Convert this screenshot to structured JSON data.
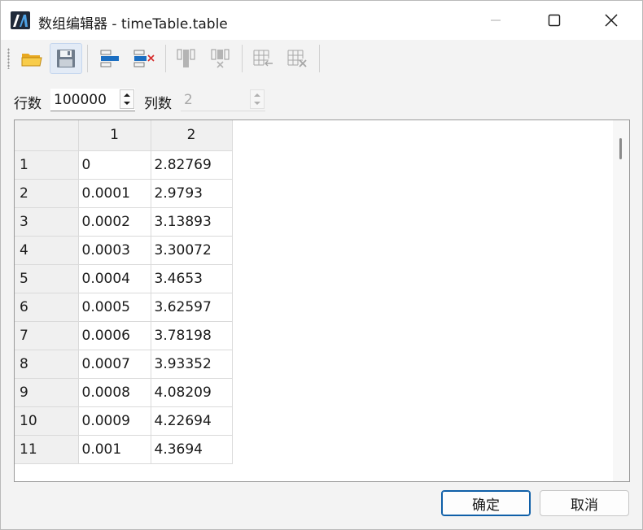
{
  "window": {
    "title": "数组编辑器 - timeTable.table"
  },
  "toolbar": {
    "buttons": [
      {
        "name": "open-folder",
        "icon": "folder-icon"
      },
      {
        "name": "save",
        "icon": "floppy-save-icon"
      },
      {
        "name": "insert-row",
        "icon": "insert-row-icon"
      },
      {
        "name": "delete-row",
        "icon": "delete-row-icon"
      },
      {
        "name": "insert-column",
        "icon": "insert-column-icon"
      },
      {
        "name": "delete-column",
        "icon": "delete-column-icon"
      },
      {
        "name": "insert-cells",
        "icon": "grid-insert-icon"
      },
      {
        "name": "delete-cells",
        "icon": "grid-delete-icon"
      }
    ]
  },
  "dims": {
    "rows_label": "行数",
    "rows_value": "100000",
    "cols_label": "列数",
    "cols_value": "2"
  },
  "table": {
    "columns": [
      "1",
      "2"
    ],
    "rows": [
      {
        "index": "1",
        "c1": "0",
        "c2": "2.82769"
      },
      {
        "index": "2",
        "c1": "0.0001",
        "c2": "2.9793"
      },
      {
        "index": "3",
        "c1": "0.0002",
        "c2": "3.13893"
      },
      {
        "index": "4",
        "c1": "0.0003",
        "c2": "3.30072"
      },
      {
        "index": "5",
        "c1": "0.0004",
        "c2": "3.4653"
      },
      {
        "index": "6",
        "c1": "0.0005",
        "c2": "3.62597"
      },
      {
        "index": "7",
        "c1": "0.0006",
        "c2": "3.78198"
      },
      {
        "index": "8",
        "c1": "0.0007",
        "c2": "3.93352"
      },
      {
        "index": "9",
        "c1": "0.0008",
        "c2": "4.08209"
      },
      {
        "index": "10",
        "c1": "0.0009",
        "c2": "4.22694"
      },
      {
        "index": "11",
        "c1": "0.001",
        "c2": "4.3694"
      }
    ]
  },
  "footer": {
    "ok_label": "确定",
    "cancel_label": "取消"
  },
  "colors": {
    "accent": "#0f5fa8",
    "title_bg": "#ffffff",
    "dialog_bg": "#f3f3f3"
  }
}
